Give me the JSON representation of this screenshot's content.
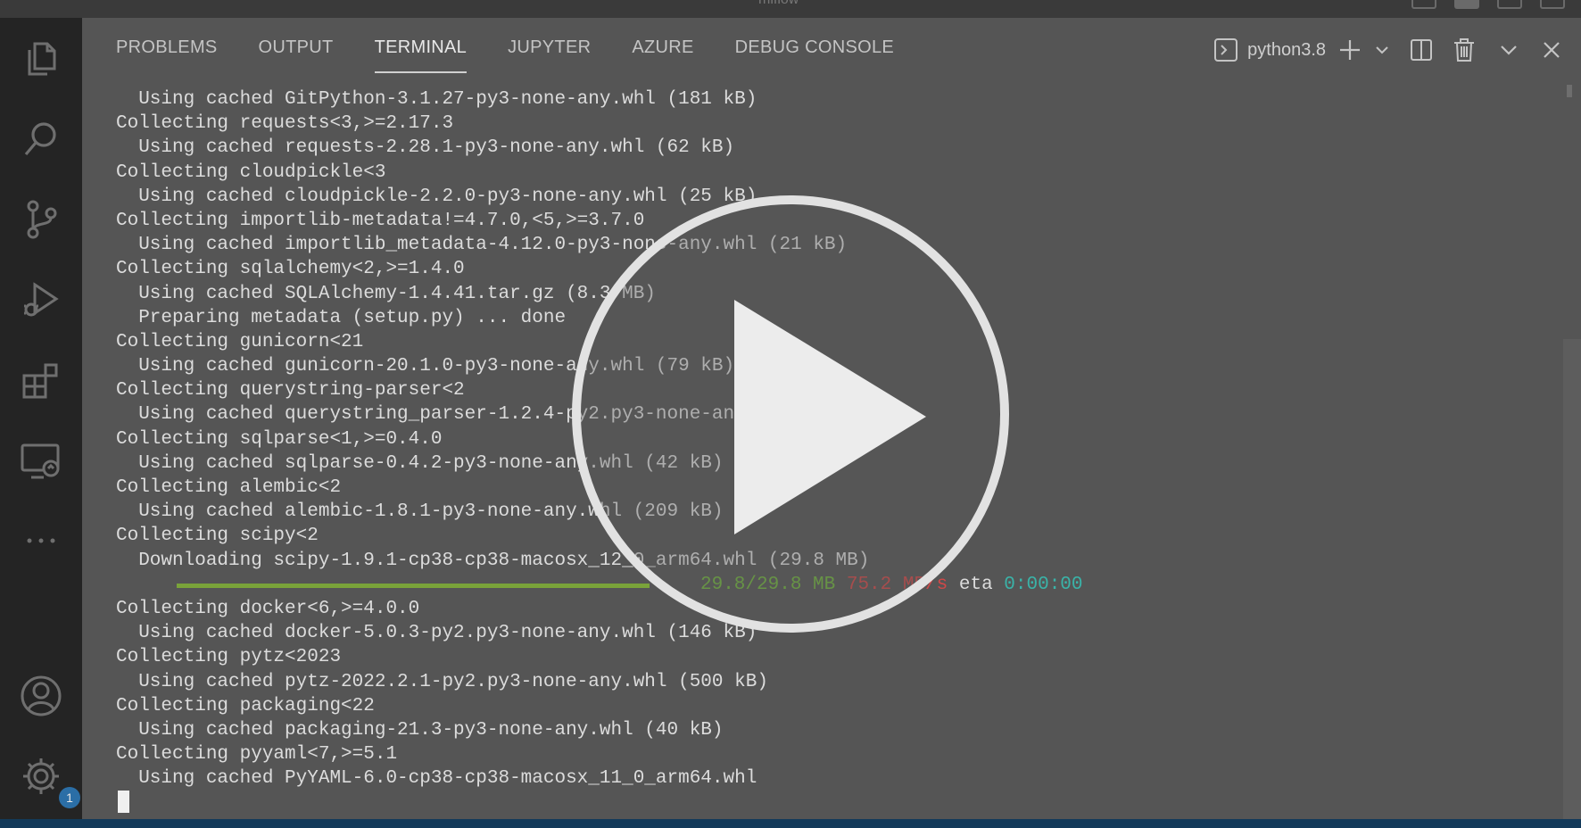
{
  "window": {
    "title": "mlflow"
  },
  "activity_bar": {
    "items": [
      {
        "name": "explorer",
        "icon": "files-icon"
      },
      {
        "name": "search",
        "icon": "search-icon"
      },
      {
        "name": "source-control",
        "icon": "source-control-icon"
      },
      {
        "name": "run-and-debug",
        "icon": "run-debug-icon"
      },
      {
        "name": "extensions",
        "icon": "extensions-icon"
      },
      {
        "name": "remote-explorer",
        "icon": "remote-explorer-icon"
      },
      {
        "name": "more",
        "icon": "ellipsis-icon"
      }
    ],
    "bottom": [
      {
        "name": "accounts",
        "icon": "account-icon"
      },
      {
        "name": "manage",
        "icon": "gear-icon",
        "badge": "1"
      }
    ]
  },
  "panel": {
    "tabs": [
      {
        "label": "PROBLEMS",
        "active": false
      },
      {
        "label": "OUTPUT",
        "active": false
      },
      {
        "label": "TERMINAL",
        "active": true
      },
      {
        "label": "JUPYTER",
        "active": false
      },
      {
        "label": "AZURE",
        "active": false
      },
      {
        "label": "DEBUG CONSOLE",
        "active": false
      }
    ],
    "terminal_name": "python3.8",
    "actions": [
      "new-terminal-icon",
      "chevron-down-icon",
      "split-terminal-icon",
      "trash-icon",
      "chevron-down-icon",
      "close-icon"
    ]
  },
  "terminal": {
    "lines_before_progress": [
      "  Using cached GitPython-3.1.27-py3-none-any.whl (181 kB)",
      "Collecting requests<3,>=2.17.3",
      "  Using cached requests-2.28.1-py3-none-any.whl (62 kB)",
      "Collecting cloudpickle<3",
      "  Using cached cloudpickle-2.2.0-py3-none-any.whl (25 kB)",
      "Collecting importlib-metadata!=4.7.0,<5,>=3.7.0",
      "  Using cached importlib_metadata-4.12.0-py3-none-any.whl (21 kB)",
      "Collecting sqlalchemy<2,>=1.4.0",
      "  Using cached SQLAlchemy-1.4.41.tar.gz (8.3 MB)",
      "  Preparing metadata (setup.py) ... done",
      "Collecting gunicorn<21",
      "  Using cached gunicorn-20.1.0-py3-none-any.whl (79 kB)",
      "Collecting querystring-parser<2",
      "  Using cached querystring_parser-1.2.4-py2.py3-none-any.whl (7.9 kB)",
      "Collecting sqlparse<1,>=0.4.0",
      "  Using cached sqlparse-0.4.2-py3-none-any.whl (42 kB)",
      "Collecting alembic<2",
      "  Using cached alembic-1.8.1-py3-none-any.whl (209 kB)",
      "Collecting scipy<2",
      "  Downloading scipy-1.9.1-cp38-cp38-macosx_12_0_arm64.whl (29.8 MB)"
    ],
    "progress": {
      "fraction": 1.0,
      "size": "29.8/29.8 MB",
      "speed": "75.2 MB/s",
      "eta_label": "eta",
      "eta": "0:00:00"
    },
    "lines_after_progress": [
      "Collecting docker<6,>=4.0.0",
      "  Using cached docker-5.0.3-py2.py3-none-any.whl (146 kB)",
      "Collecting pytz<2023",
      "  Using cached pytz-2022.2.1-py2.py3-none-any.whl (500 kB)",
      "Collecting packaging<22",
      "  Using cached packaging-21.3-py3-none-any.whl (40 kB)",
      "Collecting pyyaml<7,>=5.1",
      "  Using cached PyYAML-6.0-cp38-cp38-macosx_11_0_arm64.whl"
    ]
  },
  "overlay": {
    "icon": "play-icon"
  },
  "colors": {
    "progress_bar": "#7aa33a",
    "progress_size": "#6fb23c",
    "progress_speed": "#d04848",
    "progress_eta": "#3ab3a8",
    "badge": "#2b6ea6",
    "statusbar": "#133a5a"
  }
}
